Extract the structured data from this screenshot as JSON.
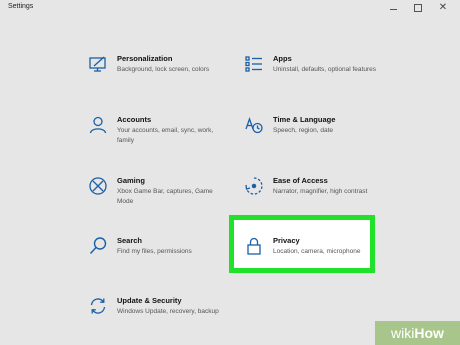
{
  "window": {
    "title": "Settings",
    "controls": {
      "minimize": "",
      "maximize": "",
      "close": "✕"
    }
  },
  "accent_color": "#1b5fa8",
  "highlight_color": "#22e12b",
  "tiles": {
    "personalization": {
      "title": "Personalization",
      "desc": "Background, lock screen, colors",
      "icon": "personalization-icon"
    },
    "apps": {
      "title": "Apps",
      "desc": "Uninstall, defaults, optional features",
      "icon": "apps-icon"
    },
    "accounts": {
      "title": "Accounts",
      "desc": "Your accounts, email, sync, work, family",
      "icon": "accounts-icon"
    },
    "time_language": {
      "title": "Time & Language",
      "desc": "Speech, region, date",
      "icon": "time-language-icon"
    },
    "gaming": {
      "title": "Gaming",
      "desc": "Xbox Game Bar, captures, Game Mode",
      "icon": "gaming-icon"
    },
    "ease_of_access": {
      "title": "Ease of Access",
      "desc": "Narrator, magnifier, high contrast",
      "icon": "ease-of-access-icon"
    },
    "search": {
      "title": "Search",
      "desc": "Find my files, permissions",
      "icon": "search-icon"
    },
    "privacy": {
      "title": "Privacy",
      "desc": "Location, camera, microphone",
      "icon": "lock-icon"
    },
    "update_security": {
      "title": "Update & Security",
      "desc": "Windows Update, recovery, backup",
      "icon": "update-icon"
    }
  },
  "watermark": {
    "prefix": "wiki",
    "suffix": "How"
  }
}
